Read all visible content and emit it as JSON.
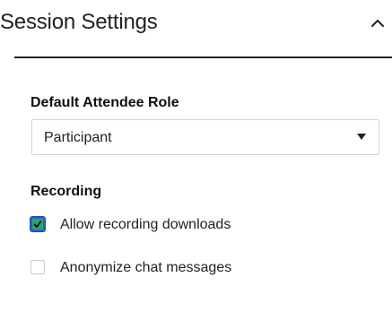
{
  "section": {
    "title": "Session Settings",
    "collapse_icon": "chevron-up-icon"
  },
  "default_role": {
    "label": "Default Attendee Role",
    "selected": "Participant",
    "caret_icon": "caret-down-icon"
  },
  "recording": {
    "label": "Recording",
    "options": [
      {
        "label": "Allow recording downloads",
        "checked": true
      },
      {
        "label": "Anonymize chat messages",
        "checked": false
      }
    ]
  },
  "colors": {
    "checkbox_fill": "#2ea36b",
    "focus_ring": "#2c5fd6"
  }
}
